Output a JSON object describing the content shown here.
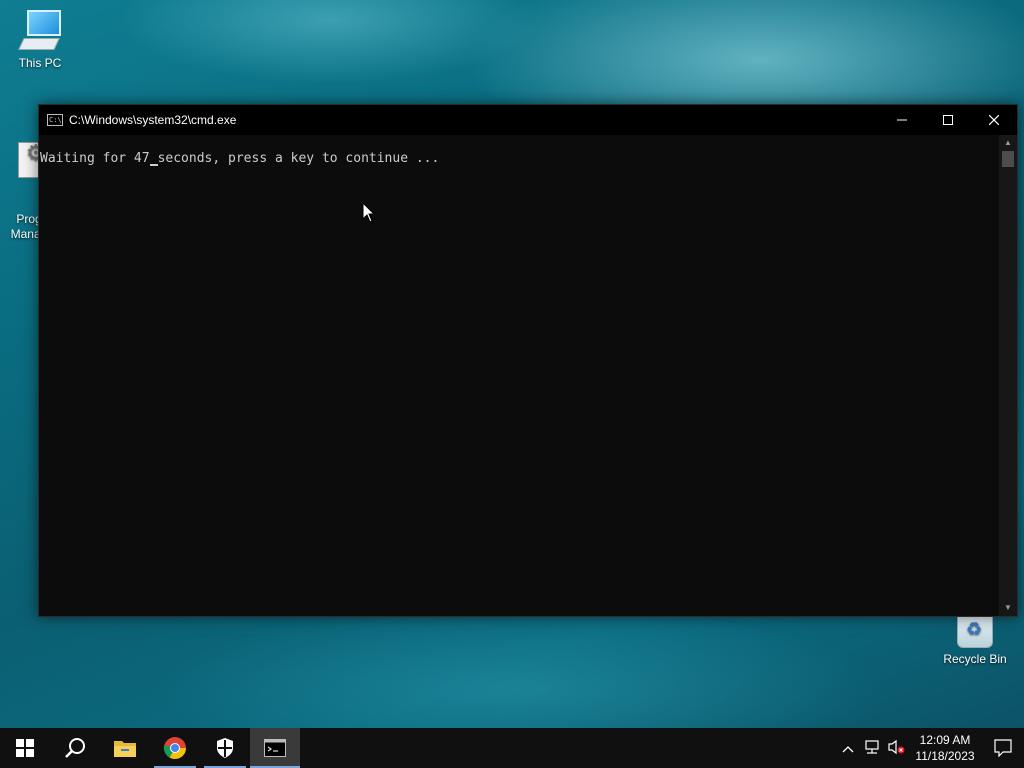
{
  "desktop": {
    "icons": [
      {
        "label": "This PC"
      },
      {
        "label": "Prog\nManag"
      },
      {
        "label": "Recycle Bin"
      }
    ]
  },
  "cmd_window": {
    "title": "C:\\Windows\\system32\\cmd.exe",
    "icon_text": "C:\\",
    "line_before_cursor": "Waiting for 47",
    "line_after_cursor": "seconds, press a key to continue ..."
  },
  "taskbar": {
    "pinned": [
      "start-icon",
      "search-icon",
      "file-explorer-icon",
      "chrome-icon",
      "windows-security-icon",
      "cmd-icon"
    ]
  },
  "tray": {
    "time": "12:09 AM",
    "date": "11/18/2023"
  },
  "colors": {
    "console_bg": "#0c0c0c",
    "console_text": "#cccccc",
    "taskbar_bg": "#101010",
    "accent": "#7aa6d9"
  }
}
